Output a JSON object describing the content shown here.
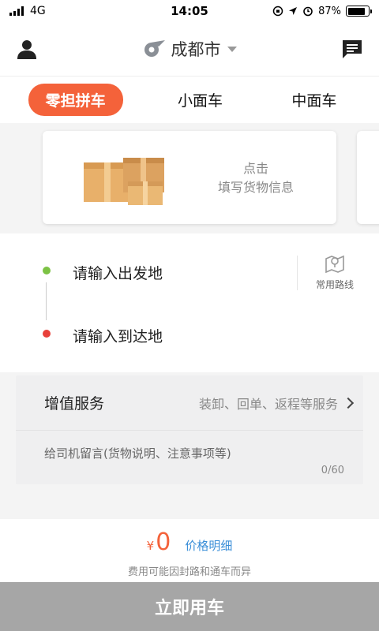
{
  "status_bar": {
    "carrier": "4G",
    "time": "14:05",
    "battery": "87%",
    "icons": [
      "signal-icon",
      "rotation-lock-icon",
      "location-arrow-icon",
      "alarm-icon",
      "battery-icon"
    ]
  },
  "header": {
    "city": "成都市",
    "icons": [
      "user-icon",
      "city-logo-icon",
      "chevron-down-icon",
      "message-icon"
    ]
  },
  "tabs": [
    {
      "label": "零担拼车",
      "active": true
    },
    {
      "label": "小面车",
      "active": false
    },
    {
      "label": "中面车",
      "active": false
    }
  ],
  "cargo": {
    "line1": "点击",
    "line2": "填写货物信息",
    "icon": "cargo-boxes-icon"
  },
  "address": {
    "from_placeholder": "请输入出发地",
    "to_placeholder": "请输入到达地",
    "routes_label": "常用路线",
    "icon": "route-map-icon"
  },
  "service": {
    "title": "增值服务",
    "hint": "装卸、回单、返程等服务",
    "message_placeholder": "给司机留言(货物说明、注意事项等)",
    "message_count": "0/60"
  },
  "price": {
    "currency": "¥",
    "amount": "0",
    "detail_link": "价格明细",
    "note": "费用可能因封路和通车而异"
  },
  "cta": {
    "label": "立即用车"
  },
  "colors": {
    "accent": "#f4623a",
    "link": "#3b8fd8",
    "start_dot": "#7cc244",
    "end_dot": "#e8403a",
    "cta_disabled": "#a6a6a6"
  }
}
